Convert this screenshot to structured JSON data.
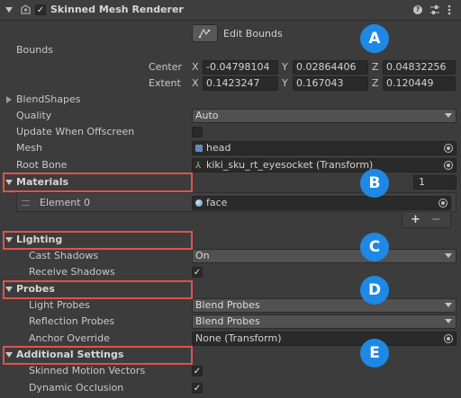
{
  "header": {
    "title": "Skinned Mesh Renderer",
    "enabled": true
  },
  "edit_bounds": {
    "label": "Edit Bounds"
  },
  "bounds": {
    "label": "Bounds",
    "center": {
      "label": "Center",
      "x": "-0.04798104",
      "y": "0.02864406",
      "z": "0.04832256"
    },
    "extent": {
      "label": "Extent",
      "x": "0.1423247",
      "y": "0.167043",
      "z": "0.120449"
    },
    "axes": {
      "x": "X",
      "y": "Y",
      "z": "Z"
    }
  },
  "blendshapes": {
    "label": "BlendShapes"
  },
  "quality": {
    "label": "Quality",
    "value": "Auto"
  },
  "update_offscreen": {
    "label": "Update When Offscreen",
    "checked": false
  },
  "mesh": {
    "label": "Mesh",
    "value": "head"
  },
  "root_bone": {
    "label": "Root Bone",
    "value": "kiki_sku_rt_eyesocket (Transform)"
  },
  "materials": {
    "label": "Materials",
    "count": "1",
    "element_label": "Element 0",
    "element_value": "face",
    "add": "+",
    "remove": "−"
  },
  "lighting": {
    "label": "Lighting",
    "cast_shadows": {
      "label": "Cast Shadows",
      "value": "On"
    },
    "receive_shadows": {
      "label": "Receive Shadows",
      "checked": true
    }
  },
  "probes": {
    "label": "Probes",
    "light_probes": {
      "label": "Light Probes",
      "value": "Blend Probes"
    },
    "reflection_probes": {
      "label": "Reflection Probes",
      "value": "Blend Probes"
    },
    "anchor_override": {
      "label": "Anchor Override",
      "value": "None (Transform)"
    }
  },
  "additional": {
    "label": "Additional Settings",
    "motion_vectors": {
      "label": "Skinned Motion Vectors",
      "checked": true
    },
    "dynamic_occlusion": {
      "label": "Dynamic Occlusion",
      "checked": true
    }
  },
  "callouts": [
    "A",
    "B",
    "C",
    "D",
    "E"
  ],
  "colors": {
    "callout": "#1e88e5",
    "highlight": "#e0524e",
    "background": "#3c3c3c",
    "field": "#2a2a2a"
  }
}
